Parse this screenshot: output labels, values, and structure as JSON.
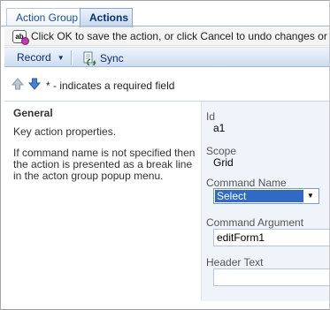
{
  "tabs": [
    {
      "label": "Action Group",
      "active": false
    },
    {
      "label": "Actions",
      "active": true
    }
  ],
  "infobar": {
    "icon": "ab-info-icon",
    "text": "Click OK to save the action, or click Cancel to undo changes or return"
  },
  "toolbar": {
    "record_label": "Record",
    "sync_label": "Sync"
  },
  "nav": {
    "required_text": "* - indicates a required field"
  },
  "category": {
    "title": "General",
    "description": "Key action properties.",
    "note": "If command name is not specified then the action is presented as a break line in the acton group popup menu."
  },
  "fields": {
    "id": {
      "label": "Id",
      "value": "a1"
    },
    "scope": {
      "label": "Scope",
      "value": "Grid"
    },
    "command_name": {
      "label": "Command Name",
      "value": "Select"
    },
    "command_argument": {
      "label": "Command Argument",
      "value": "editForm1"
    },
    "header_text": {
      "label": "Header Text",
      "value": ""
    }
  },
  "colors": {
    "accent": "#1d4f99",
    "toolbar_bg": "#cddcf0",
    "fields_bg": "#eff4fb",
    "select_highlight": "#316ac5"
  }
}
